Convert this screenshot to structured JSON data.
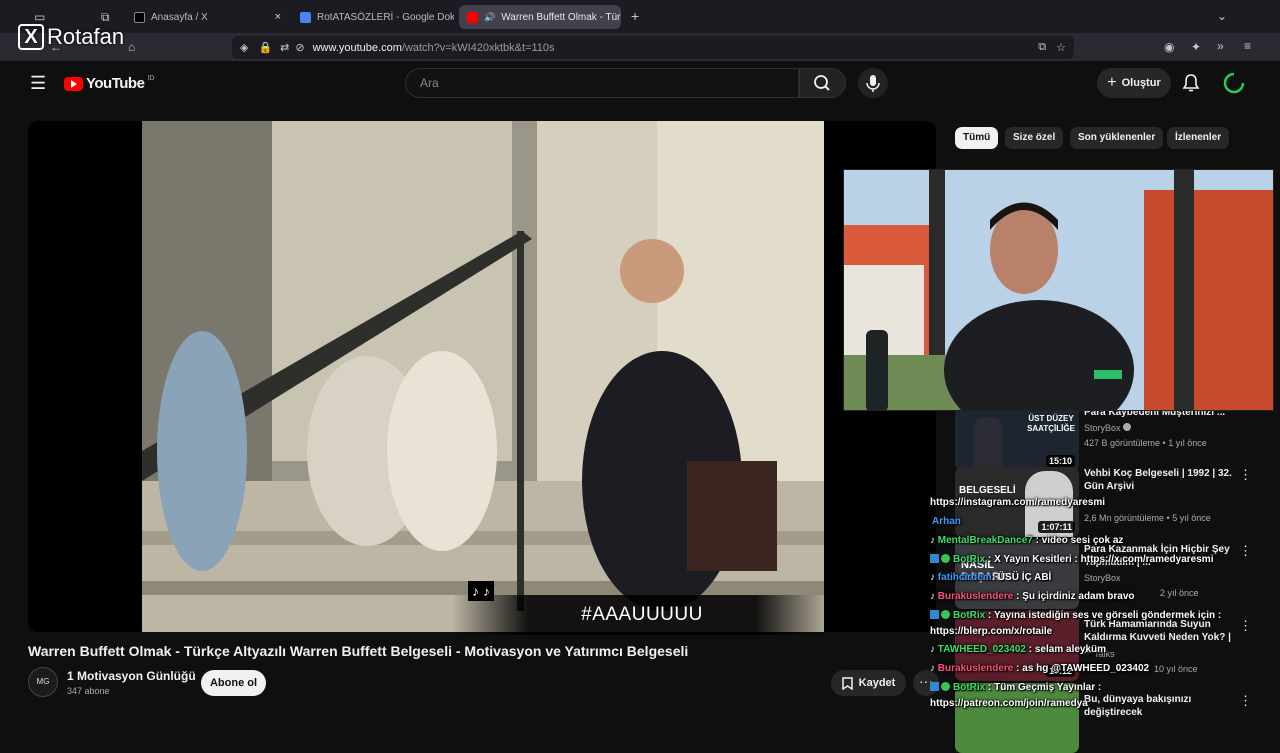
{
  "browser": {
    "tabs": [
      {
        "label": "Anasayfa / X",
        "active": false
      },
      {
        "label": "RotATASÖZLERİ - Google Doküm",
        "active": false
      },
      {
        "label": "Warren Buffett Olmak - Türk",
        "active": true
      }
    ],
    "close_glyph": "×",
    "new_tab_glyph": "+",
    "url_host": "www.youtube.com",
    "url_path": "/watch?v=kWI420xktbk&t=110s"
  },
  "watermark": {
    "logo": "X",
    "text": "Rotafan"
  },
  "youtube": {
    "logo_text": "YouTube",
    "region": "ID",
    "search_placeholder": "Ara",
    "create_label": "Oluştur",
    "video": {
      "title": "Warren Buffett Olmak - Türkçe Altyazılı Warren Buffett Belgeseli - Motivasyon ve Yatırımcı Belgeseli",
      "caption_glyph": "♪ ♪",
      "channel_name": "1 Motivasyon Günlüğü",
      "channel_avatar": "MG",
      "subscribers": "347 abone",
      "subscribe_label": "Abone ol",
      "save_label": "Kaydet",
      "more_glyph": "···"
    },
    "chips": [
      {
        "label": "Tümü",
        "selected": true
      },
      {
        "label": "Size özel",
        "selected": false
      },
      {
        "label": "Son yüklenenler",
        "selected": false
      },
      {
        "label": "İzlenenler",
        "selected": false
      }
    ],
    "recommendations": [
      {
        "title": "Para Kaybedeni Müşterinizi ...",
        "channel": "StoryBox",
        "meta": "427 B görüntüleme • 1 yıl önce",
        "duration": "15:10",
        "thumb_text": "DÜKKANDAN ÜST DÜZEY SAATÇİLİĞE"
      },
      {
        "title": "Vehbi Koç Belgeseli | 1992 | 32. Gün Arşivi",
        "channel": "",
        "meta": "2,6 Mn görüntüleme • 5 yıl önce",
        "duration": "1:07:11",
        "thumb_text": "BELGESELİ"
      },
      {
        "title": "Para Kazanmak İçin Hiçbir Şey Yapmadım | ...",
        "channel": "StoryBox",
        "meta": "2 yıl önce",
        "duration": "",
        "thumb_text": "NASIL BAŞARDI"
      },
      {
        "title": "Türk Hamamlarında Suyun Kaldırma Kuvveti Neden Yok? | ...",
        "channel": "Talks",
        "meta": "10 yıl önce",
        "duration": "19:12",
        "thumb_text": ""
      },
      {
        "title": "Bu, dünyaya bakışınızı değiştirecek",
        "channel": "",
        "meta": "",
        "duration": "",
        "thumb_text": ""
      }
    ],
    "rec_menu_glyph": "⋮"
  },
  "hashtag_banner": "#AAAUUUUU",
  "chat": [
    {
      "user": "",
      "text": "https://instagram.com/ramedyaresmi",
      "color": "u"
    },
    {
      "user": "Arhan",
      "text": "",
      "color": "ub"
    },
    {
      "user": "MentalBreakDance7",
      "text": ": video sesi çok az",
      "color": "u"
    },
    {
      "user": "BotRix",
      "text": ": X Yayın Kesitleri : https://x.com/ramedyaresmi",
      "color": "u"
    },
    {
      "user": "fatihcirdem",
      "text": ": ÜSÜ İÇ ABİ",
      "color": "ub"
    },
    {
      "user": "Burakuslendere",
      "text": ": Şu içirdiniz adam bravo",
      "color": "ur"
    },
    {
      "user": "BotRix",
      "text": ": Yayına istediğin ses ve görseli göndermek için :",
      "color": "u"
    },
    {
      "user": "",
      "text": "https://blerp.com/x/rotaile",
      "color": "u"
    },
    {
      "user": "TAWHEED_023402",
      "text": ": selam aleyküm",
      "color": "u"
    },
    {
      "user": "Burakuslendere",
      "text": ": as hg @TAWHEED_023402",
      "color": "ur"
    },
    {
      "user": "BotRix",
      "text": ": Tüm Geçmiş Yayınlar :",
      "color": "u"
    },
    {
      "user": "",
      "text": "https://patreon.com/join/ramedya",
      "color": "u"
    }
  ],
  "colors": {
    "yt_red": "#ff0000",
    "page_bg": "#0f0f0f",
    "chat_user_green": "#38e06a",
    "chat_user_red": "#ff4f7a"
  }
}
